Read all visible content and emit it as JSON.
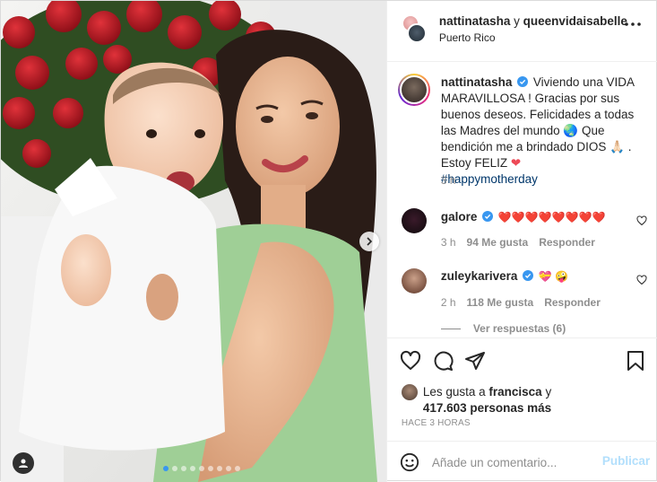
{
  "header": {
    "user1": "nattinatasha",
    "connector": " y ",
    "user2": "queenvidaisabelle",
    "location": "Puerto Rico"
  },
  "caption": {
    "user": "nattinatasha",
    "text1": "Viviendo una VIDA MARAVILLOSA ! Gracias por sus buenos deseos. Felicidades a todas las Madres del mundo",
    "text2": "Que bendición me a brindado DIOS",
    "text3": ". Estoy FELIZ",
    "hashtag": "#happymotherday",
    "time": "3 h"
  },
  "comments": [
    {
      "user": "galore",
      "text": "❤️❤️❤️❤️❤️❤️❤️❤️",
      "time": "3 h",
      "likes": "94 Me gusta",
      "reply": "Responder"
    },
    {
      "user": "zuleykarivera",
      "text": "💝 🤪",
      "time": "2 h",
      "likes": "118 Me gusta",
      "reply": "Responder"
    }
  ],
  "replies_label": "Ver respuestas (6)",
  "likes": {
    "prefix": "Les gusta a ",
    "user": "francisca",
    "middle": " y",
    "count": "417.603 personas más"
  },
  "timeago": "HACE 3 HORAS",
  "composer": {
    "placeholder": "Añade un comentario...",
    "publish": "Publicar"
  },
  "carousel": {
    "count": 9,
    "active_index": 0
  },
  "colors": {
    "verified": "#3897f0",
    "link": "#00376b",
    "heart": "#ed4956",
    "publish_disabled": "#b2dffc"
  },
  "icons": [
    "more-icon",
    "verified-icon",
    "heart-icon",
    "comment-icon",
    "share-icon",
    "bookmark-icon",
    "emoji-icon",
    "chevron-right-icon",
    "user-tag-icon"
  ]
}
